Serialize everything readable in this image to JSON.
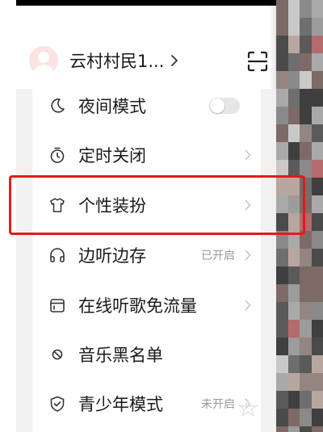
{
  "user": {
    "name": "云村村民1...",
    "avatar": "default-avatar"
  },
  "menu": [
    {
      "id": "night-mode",
      "label": "夜间模式",
      "icon": "moon-icon",
      "trailing": "toggle",
      "on": false
    },
    {
      "id": "timer-off",
      "label": "定时关闭",
      "icon": "timer-icon",
      "trailing": "chevron"
    },
    {
      "id": "skins",
      "label": "个性装扮",
      "icon": "tshirt-icon",
      "trailing": "chevron",
      "highlighted": true
    },
    {
      "id": "listen-cache",
      "label": "边听边存",
      "icon": "headphones-icon",
      "trailing": "chevron",
      "status": "已开启"
    },
    {
      "id": "free-data",
      "label": "在线听歌免流量",
      "icon": "sim-card-icon",
      "trailing": "chevron"
    },
    {
      "id": "blocklist",
      "label": "音乐黑名单",
      "icon": "block-icon",
      "trailing": "none"
    },
    {
      "id": "teen-mode",
      "label": "青少年模式",
      "icon": "shield-icon",
      "trailing": "chevron",
      "status": "未开启"
    }
  ],
  "colors": {
    "highlight": "#e61919",
    "text": "#1a1a1a",
    "status": "#9a9a9a",
    "toggle_off": "#e6e6e6"
  }
}
